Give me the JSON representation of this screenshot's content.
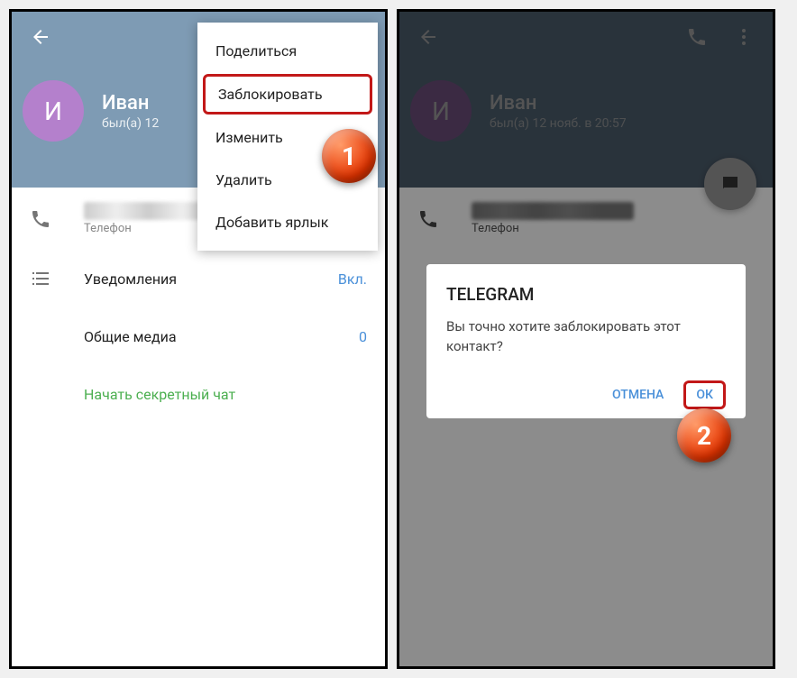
{
  "left": {
    "profile": {
      "avatar_initial": "И",
      "name": "Иван",
      "status": "был(а) 12"
    },
    "menu": {
      "share": "Поделиться",
      "block": "Заблокировать",
      "edit": "Изменить",
      "delete": "Удалить",
      "shortcut": "Добавить ярлык"
    },
    "rows": {
      "phone_label": "Телефон",
      "notifications": "Уведомления",
      "notifications_value": "Вкл.",
      "shared_media": "Общие медиа",
      "shared_media_value": "0",
      "secret_chat": "Начать секретный чат"
    },
    "step": "1"
  },
  "right": {
    "profile": {
      "avatar_initial": "И",
      "name": "Иван",
      "status": "был(а) 12 нояб. в 20:57"
    },
    "rows": {
      "phone_label": "Телефон"
    },
    "dialog": {
      "title": "TELEGRAM",
      "message": "Вы точно хотите заблокировать этот контакт?",
      "cancel": "ОТМЕНА",
      "ok": "ОК"
    },
    "step": "2"
  }
}
